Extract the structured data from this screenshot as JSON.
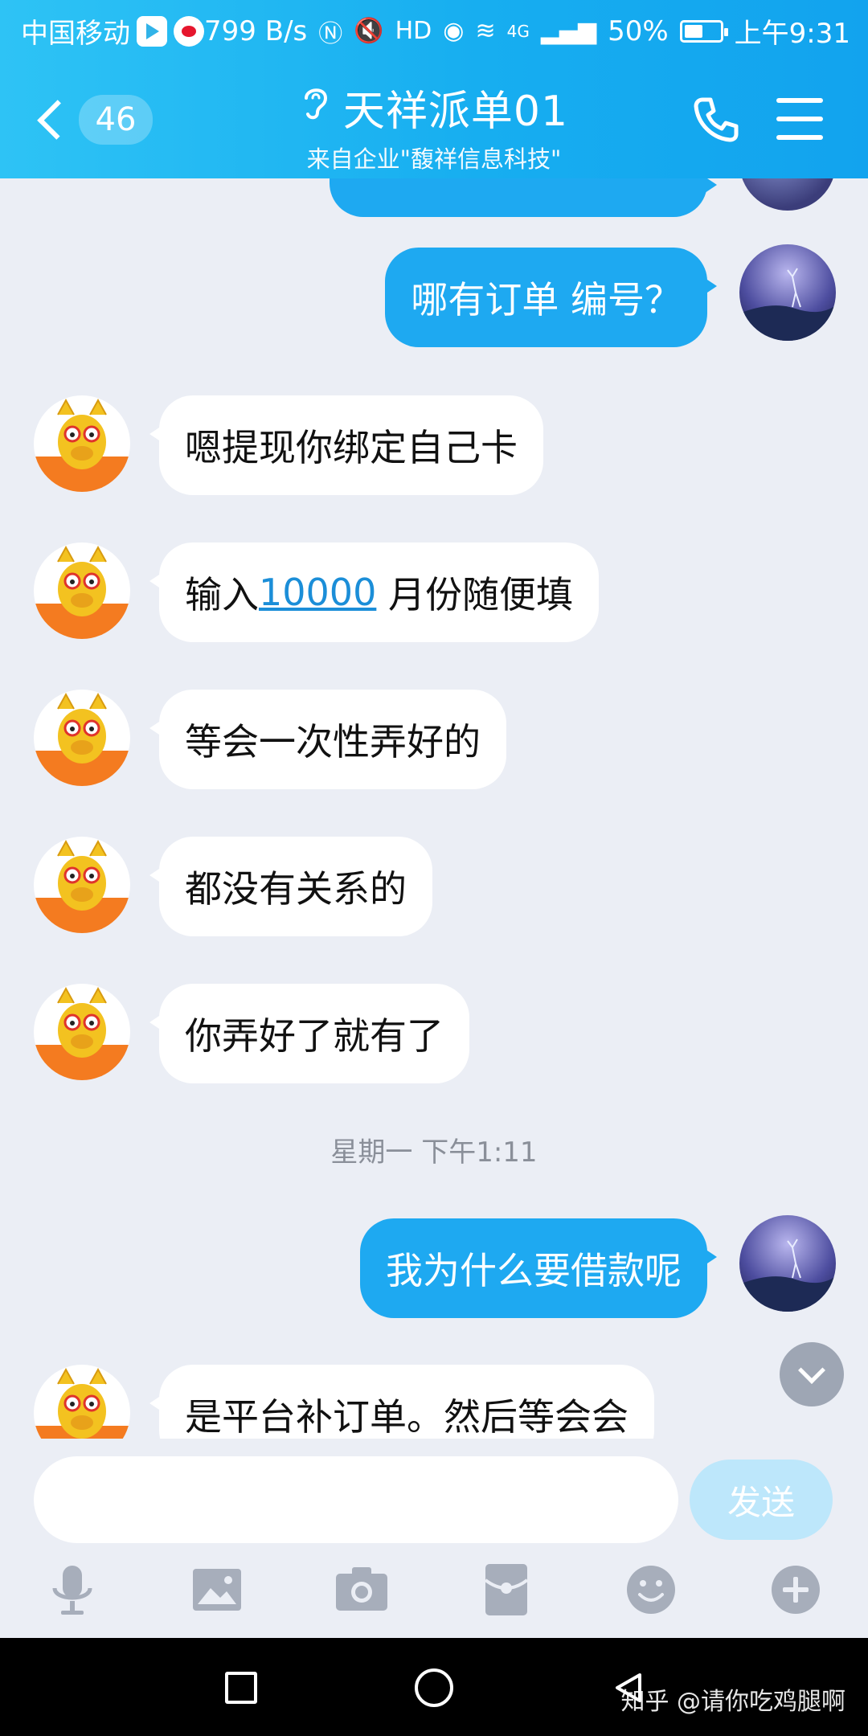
{
  "status_bar": {
    "carrier": "中国移动",
    "net_speed": "799 B/s",
    "network_label": "4G",
    "battery": "50%",
    "time": "上午9:31"
  },
  "header": {
    "unread_count": "46",
    "title": "天祥派单01",
    "subtitle": "来自企业\"馥祥信息科技\""
  },
  "messages": [
    {
      "side": "out",
      "text": "哪有订单 编号？"
    },
    {
      "side": "in",
      "text": "嗯提现你绑定自己卡"
    },
    {
      "side": "in",
      "text_before": "输入",
      "link": "10000",
      "text_after": " 月份随便填"
    },
    {
      "side": "in",
      "text": "等会一次性弄好的"
    },
    {
      "side": "in",
      "text": "都没有关系的"
    },
    {
      "side": "in",
      "text": "你弄好了就有了"
    },
    {
      "side": "out",
      "text": "我为什么要借款呢"
    },
    {
      "side": "in",
      "text": "是平台补订单。然后等会会"
    }
  ],
  "timestamp": "星期一 下午1:11",
  "composer": {
    "placeholder": "",
    "send_label": "发送"
  },
  "toolbar_icons": [
    "microphone-icon",
    "image-icon",
    "camera-icon",
    "red-packet-icon",
    "emoji-icon",
    "plus-icon"
  ],
  "watermark": "知乎 @请你吃鸡腿啊",
  "colors": {
    "header_accent": "#17aef0",
    "outgoing_bubble": "#1ea9f1",
    "incoming_bubble": "#ffffff",
    "chat_background": "#ebeef5",
    "send_button": "#bde7fb"
  }
}
